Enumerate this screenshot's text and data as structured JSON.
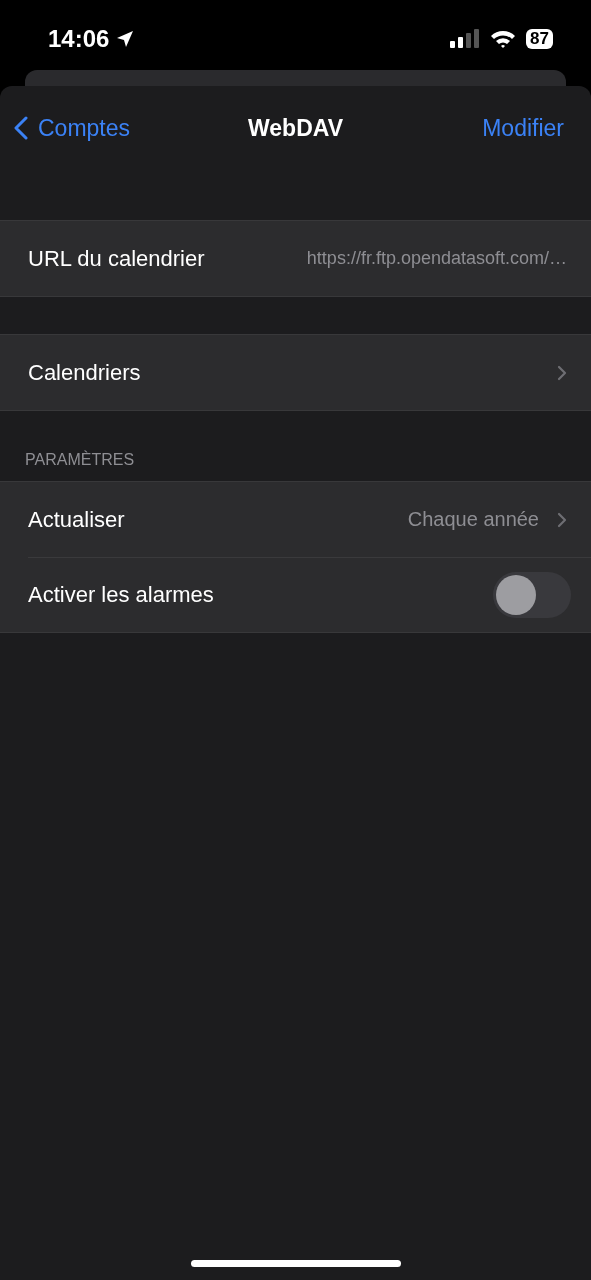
{
  "status_bar": {
    "time": "14:06",
    "battery": "87"
  },
  "nav": {
    "back": "Comptes",
    "title": "WebDAV",
    "action": "Modifier"
  },
  "groups": [
    {
      "rows": [
        {
          "kind": "value",
          "label": "URL du calendrier",
          "value": "https://fr.ftp.opendatasoft.com/…"
        }
      ]
    },
    {
      "rows": [
        {
          "kind": "link",
          "label": "Calendriers"
        }
      ]
    },
    {
      "header": "PARAMÈTRES",
      "rows": [
        {
          "kind": "link",
          "label": "Actualiser",
          "value": "Chaque année"
        },
        {
          "kind": "toggle",
          "label": "Activer les alarmes",
          "on": false
        }
      ]
    }
  ]
}
